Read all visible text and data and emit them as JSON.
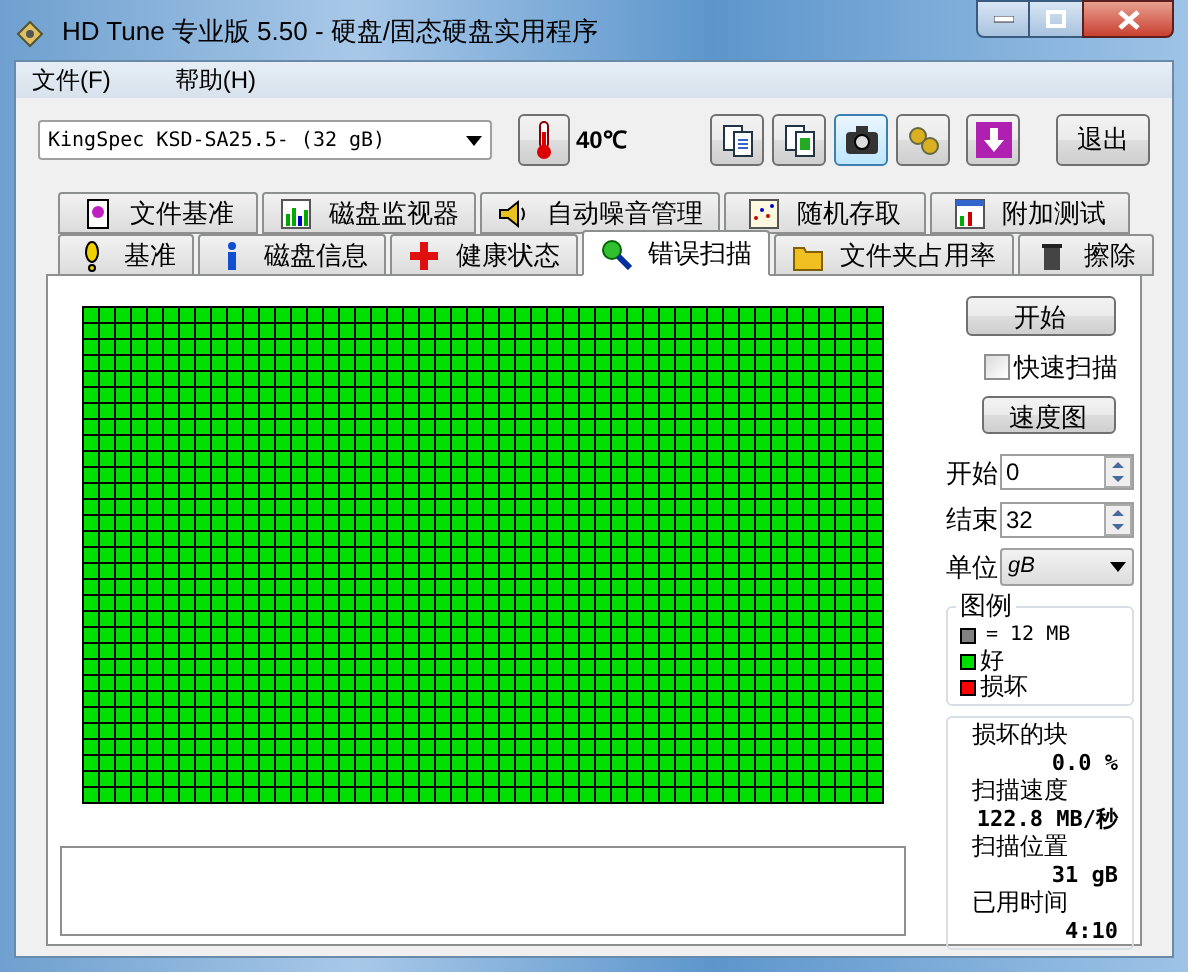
{
  "window": {
    "title": "HD Tune 专业版 5.50 - 硬盘/固态硬盘实用程序"
  },
  "menu": [
    "文件(F)",
    "帮助(H)"
  ],
  "toolbar": {
    "drive": "KingSpec KSD-SA25.5- (32 gB)",
    "temperature": "40℃",
    "tool_buttons": [
      {
        "selected": false
      },
      {
        "selected": false
      },
      {
        "selected": true
      },
      {
        "selected": false
      },
      {
        "selected": false
      }
    ],
    "exit_button": "退出"
  },
  "tabs_back": [
    {
      "label": "文件基准",
      "selected": false
    },
    {
      "label": "磁盘监视器",
      "selected": false
    },
    {
      "label": "自动噪音管理",
      "selected": false
    },
    {
      "label": "随机存取",
      "selected": false
    },
    {
      "label": "附加测试",
      "selected": false
    }
  ],
  "tabs_front": [
    {
      "label": "基准",
      "selected": false
    },
    {
      "label": "磁盘信息",
      "selected": false
    },
    {
      "label": "健康状态",
      "selected": false
    },
    {
      "label": "错误扫描",
      "selected": true
    },
    {
      "label": "文件夹占用率",
      "selected": false
    },
    {
      "label": "擦除",
      "selected": false
    }
  ],
  "scan": {
    "start_button": "开始",
    "quick_scan": {
      "label": "快速扫描",
      "checked": false
    },
    "speed_map_button": "速度图",
    "start": {
      "label": "开始",
      "value": "0"
    },
    "end": {
      "label": "结束",
      "value": "32"
    },
    "unit": {
      "label": "单位",
      "value": "gB"
    },
    "legend": {
      "title": "图例",
      "items": [
        {
          "label": "= 12 MB",
          "color": "#808080"
        },
        {
          "label": "好",
          "color": "#00e000"
        },
        {
          "label": "损坏",
          "color": "#ff0000"
        }
      ]
    },
    "stats": [
      {
        "label": "损坏的块",
        "value": "0.0 %"
      },
      {
        "label": "扫描速度",
        "value": "122.8 MB/秒"
      },
      {
        "label": "扫描位置",
        "value": "31 gB"
      },
      {
        "label": "已用时间",
        "value": "4:10"
      }
    ]
  }
}
